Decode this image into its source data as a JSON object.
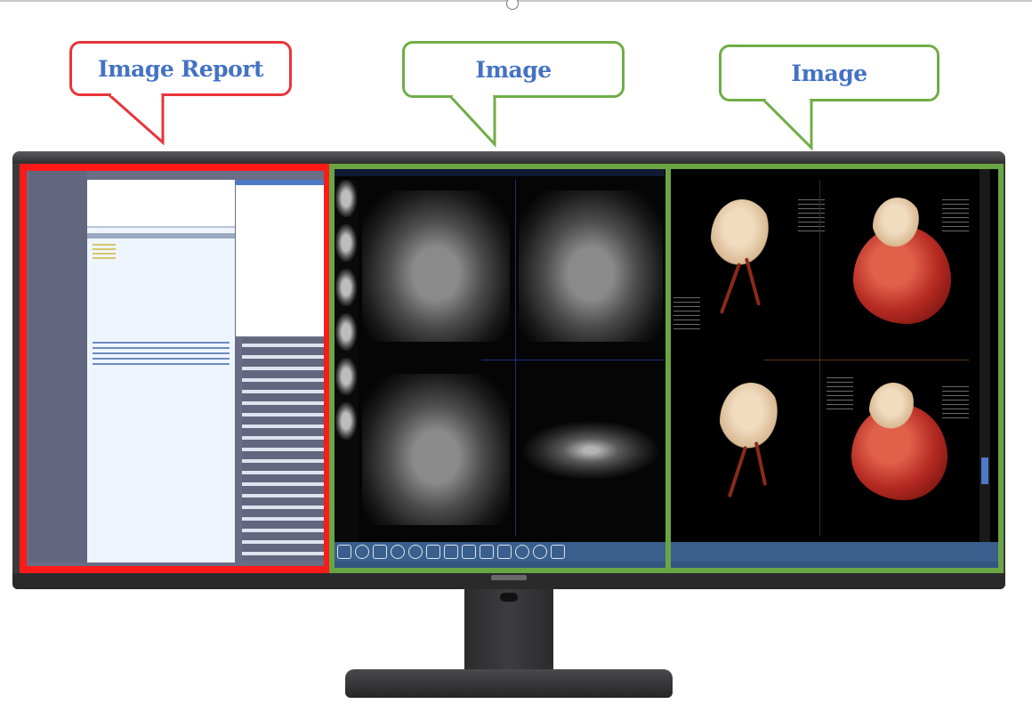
{
  "callouts": {
    "report": {
      "label": "Image Report",
      "color": "#e8353a"
    },
    "image_left": {
      "label": "Image",
      "color": "#70ad47"
    },
    "image_right": {
      "label": "Image",
      "color": "#70ad47"
    }
  },
  "colors": {
    "label_text": "#4472c4",
    "report_frame": "#ff1a1a",
    "image_frame": "#6aa544",
    "monitor_body": "#3a3a3c"
  },
  "panels": {
    "report": {
      "content": "radiology report editor"
    },
    "mr": {
      "content": "mr coronal and axial viewer"
    },
    "vr": {
      "content": "3d cardiac volume rendering"
    }
  },
  "toolbar": {
    "icons": [
      "pointer-icon",
      "contrast-icon",
      "pan-icon",
      "zoom-icon",
      "window-level-icon",
      "layout-icon",
      "grid-icon",
      "ruler-icon",
      "angle-icon",
      "rectangle-icon",
      "ellipse-icon",
      "rotate-icon",
      "print-icon"
    ]
  }
}
